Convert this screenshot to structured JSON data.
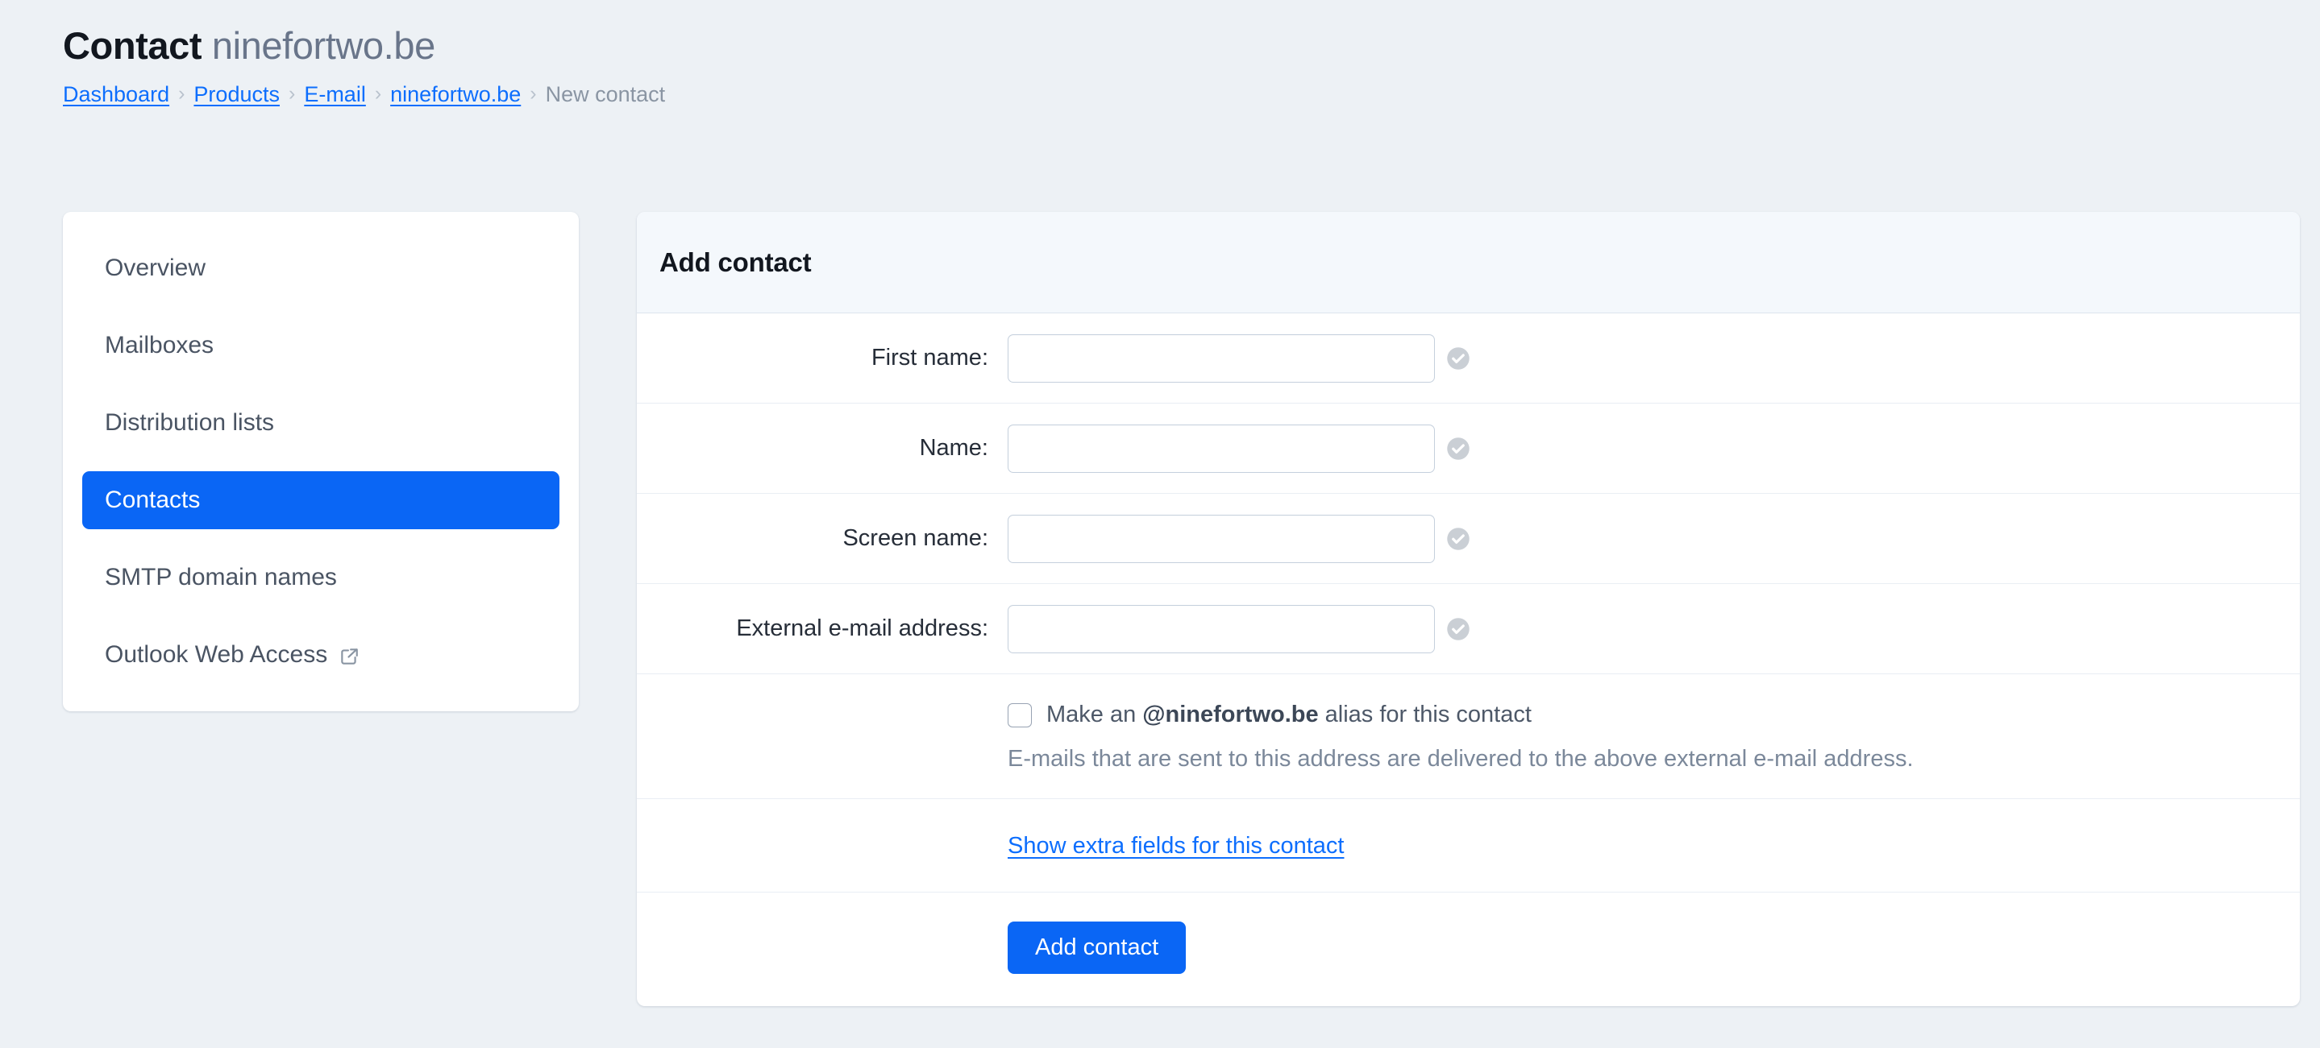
{
  "header": {
    "title_strong": "Contact",
    "title_muted": "ninefortwo.be",
    "breadcrumb": {
      "items": [
        {
          "label": "Dashboard",
          "link": true
        },
        {
          "label": "Products",
          "link": true
        },
        {
          "label": "E-mail",
          "link": true
        },
        {
          "label": "ninefortwo.be",
          "link": true
        },
        {
          "label": "New contact",
          "link": false
        }
      ],
      "separator": "›"
    }
  },
  "sidebar": {
    "items": [
      {
        "label": "Overview",
        "active": false,
        "external": false
      },
      {
        "label": "Mailboxes",
        "active": false,
        "external": false
      },
      {
        "label": "Distribution lists",
        "active": false,
        "external": false
      },
      {
        "label": "Contacts",
        "active": true,
        "external": false
      },
      {
        "label": "SMTP domain names",
        "active": false,
        "external": false
      },
      {
        "label": "Outlook Web Access",
        "active": false,
        "external": true
      }
    ]
  },
  "card": {
    "title": "Add contact",
    "fields": [
      {
        "label": "First name:",
        "value": "",
        "placeholder": ""
      },
      {
        "label": "Name:",
        "value": "",
        "placeholder": ""
      },
      {
        "label": "Screen name:",
        "value": "",
        "placeholder": ""
      },
      {
        "label": "External e-mail address:",
        "value": "",
        "placeholder": ""
      }
    ],
    "alias": {
      "checked": false,
      "text_before": "Make an",
      "domain": "@ninefortwo.be",
      "text_after": "alias for this contact",
      "help": "E-mails that are sent to this address are delivered to the above external e-mail address."
    },
    "extra_fields_link": "Show extra fields for this contact",
    "submit_label": "Add contact"
  },
  "colors": {
    "accent": "#0a66f5",
    "link": "#0d6efd",
    "page_bg": "#edf1f5",
    "card_header_bg": "#f4f8fc",
    "border": "#e9eef4",
    "input_border": "#c5d0dd",
    "muted_text": "#7b889a"
  }
}
